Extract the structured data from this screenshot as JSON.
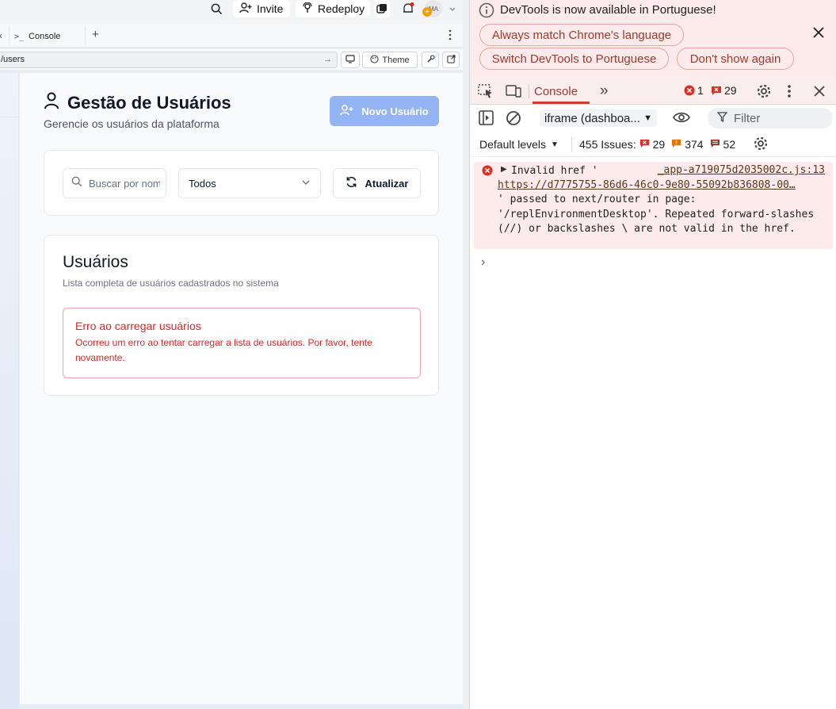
{
  "topbar": {
    "invite_label": "Invite",
    "redeploy_label": "Redeploy",
    "avatar_initials": "MA"
  },
  "tabstrip": {
    "console_tab_label": "Console",
    "add_tab": "+"
  },
  "urlbar": {
    "path": "/users",
    "theme_label": "Theme"
  },
  "app": {
    "title": "Gestão de Usuários",
    "subtitle": "Gerencie os usuários da plataforma",
    "new_user_button": "Novo Usuário",
    "search_placeholder": "Buscar por nome",
    "filter_value": "Todos",
    "refresh_button": "Atualizar",
    "users_card_title": "Usuários",
    "users_card_subtitle": "Lista completa de usuários cadastrados no sistema",
    "error_title": "Erro ao carregar usuários",
    "error_description": "Ocorreu um erro ao tentar carregar a lista de usuários. Por favor, tente novamente."
  },
  "devtools": {
    "info_text": "DevTools is now available in Portuguese!",
    "always_match_button": "Always match Chrome's language",
    "switch_button": "Switch DevTools to Portuguese",
    "dont_show_button": "Don't show again",
    "console_tab": "Console",
    "error_count": "1",
    "issue_badge_count": "29",
    "context_select": "iframe (dashboa...",
    "filter_placeholder": "Filter",
    "default_levels": "Default levels",
    "issues_label": "455 Issues:",
    "issues_errors": "29",
    "issues_warnings": "374",
    "issues_info": "52",
    "message_prefix": "Invalid href '",
    "message_source": "_app-a719075d2035002c.js:13",
    "message_url": "https://d7775755-86d6-46c0-9e80-55092b836808-00…",
    "message_body": "' passed to next/router in page: '/replEnvironmentDesktop'. Repeated forward-slashes (//) or backslashes \\ are not valid in the href."
  },
  "colors": {
    "primary_button_disabled": "#93b4f5",
    "error_red": "#dc2626",
    "devtools_banner": "#fcebea",
    "devtools_accent": "#c5402f"
  }
}
